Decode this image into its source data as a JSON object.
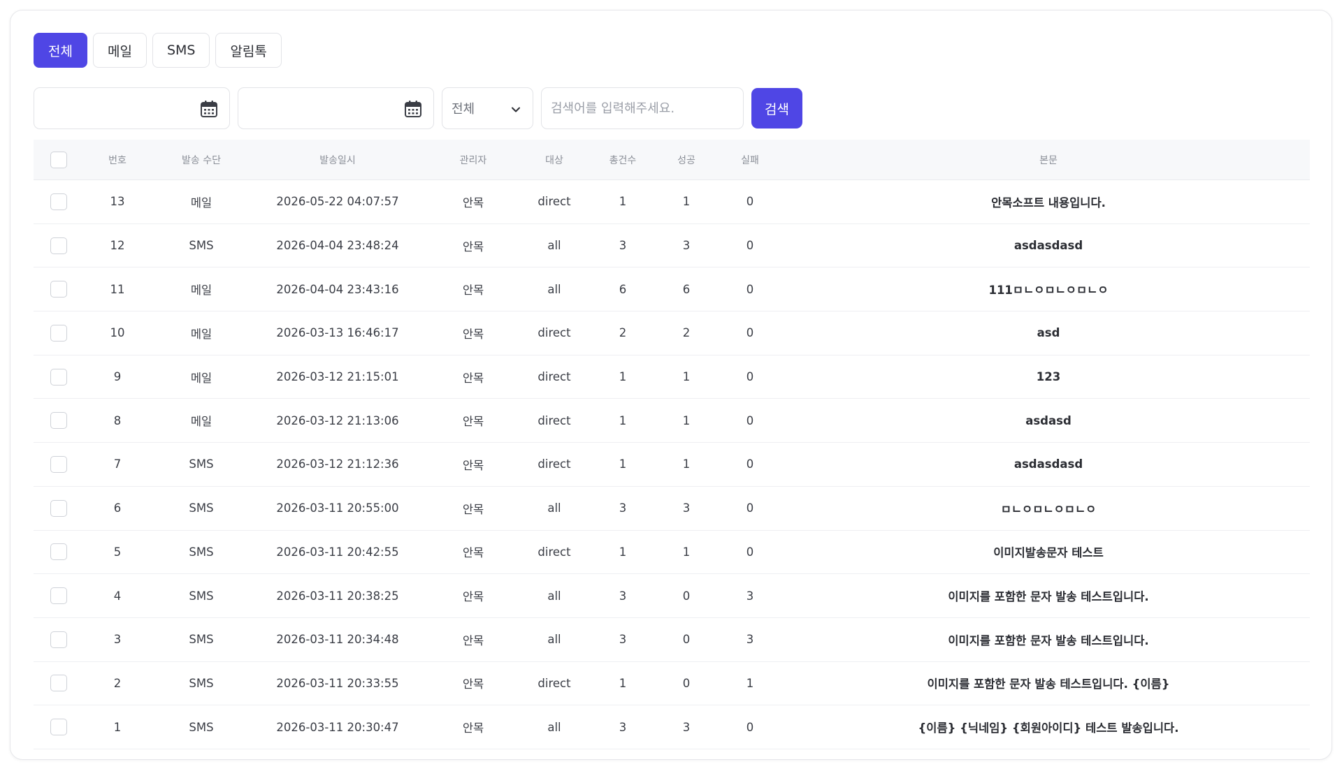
{
  "tabs": [
    {
      "label": "전체",
      "active": true
    },
    {
      "label": "메일",
      "active": false
    },
    {
      "label": "SMS",
      "active": false
    },
    {
      "label": "알림톡",
      "active": false
    }
  ],
  "filters": {
    "start_date": "",
    "end_date": "",
    "select_value": "전체",
    "search_placeholder": "검색어를 입력해주세요.",
    "search_button": "검색"
  },
  "table": {
    "headers": {
      "no": "번호",
      "method": "발송 수단",
      "date": "발송일시",
      "admin": "관리자",
      "target": "대상",
      "total": "총건수",
      "success": "성공",
      "fail": "실패",
      "body": "본문"
    },
    "rows": [
      {
        "no": "13",
        "method": "메일",
        "date": "2026-05-22 04:07:57",
        "admin": "안목",
        "target": "direct",
        "total": "1",
        "success": "1",
        "fail": "0",
        "body": "안목소프트 내용입니다."
      },
      {
        "no": "12",
        "method": "SMS",
        "date": "2026-04-04 23:48:24",
        "admin": "안목",
        "target": "all",
        "total": "3",
        "success": "3",
        "fail": "0",
        "body": "asdasdasd"
      },
      {
        "no": "11",
        "method": "메일",
        "date": "2026-04-04 23:43:16",
        "admin": "안목",
        "target": "all",
        "total": "6",
        "success": "6",
        "fail": "0",
        "body": "111ㅁㄴㅇㅁㄴㅇㅁㄴㅇ"
      },
      {
        "no": "10",
        "method": "메일",
        "date": "2026-03-13 16:46:17",
        "admin": "안목",
        "target": "direct",
        "total": "2",
        "success": "2",
        "fail": "0",
        "body": "asd"
      },
      {
        "no": "9",
        "method": "메일",
        "date": "2026-03-12 21:15:01",
        "admin": "안목",
        "target": "direct",
        "total": "1",
        "success": "1",
        "fail": "0",
        "body": "123"
      },
      {
        "no": "8",
        "method": "메일",
        "date": "2026-03-12 21:13:06",
        "admin": "안목",
        "target": "direct",
        "total": "1",
        "success": "1",
        "fail": "0",
        "body": "asdasd"
      },
      {
        "no": "7",
        "method": "SMS",
        "date": "2026-03-12 21:12:36",
        "admin": "안목",
        "target": "direct",
        "total": "1",
        "success": "1",
        "fail": "0",
        "body": "asdasdasd"
      },
      {
        "no": "6",
        "method": "SMS",
        "date": "2026-03-11 20:55:00",
        "admin": "안목",
        "target": "all",
        "total": "3",
        "success": "3",
        "fail": "0",
        "body": "ㅁㄴㅇㅁㄴㅇㅁㄴㅇ"
      },
      {
        "no": "5",
        "method": "SMS",
        "date": "2026-03-11 20:42:55",
        "admin": "안목",
        "target": "direct",
        "total": "1",
        "success": "1",
        "fail": "0",
        "body": "이미지발송문자 테스트"
      },
      {
        "no": "4",
        "method": "SMS",
        "date": "2026-03-11 20:38:25",
        "admin": "안목",
        "target": "all",
        "total": "3",
        "success": "0",
        "fail": "3",
        "body": "이미지를 포함한 문자 발송 테스트입니다."
      },
      {
        "no": "3",
        "method": "SMS",
        "date": "2026-03-11 20:34:48",
        "admin": "안목",
        "target": "all",
        "total": "3",
        "success": "0",
        "fail": "3",
        "body": "이미지를 포함한 문자 발송 테스트입니다."
      },
      {
        "no": "2",
        "method": "SMS",
        "date": "2026-03-11 20:33:55",
        "admin": "안목",
        "target": "direct",
        "total": "1",
        "success": "0",
        "fail": "1",
        "body": "이미지를 포함한 문자 발송 테스트입니다. {이름}"
      },
      {
        "no": "1",
        "method": "SMS",
        "date": "2026-03-11 20:30:47",
        "admin": "안목",
        "target": "all",
        "total": "3",
        "success": "3",
        "fail": "0",
        "body": "{이름} {닉네임} {회원아이디} 테스트 발송입니다."
      }
    ]
  },
  "icons": {
    "calendar": "calendar-icon",
    "chevron": "chevron-down-icon"
  },
  "colors": {
    "accent": "#4f46e5"
  }
}
